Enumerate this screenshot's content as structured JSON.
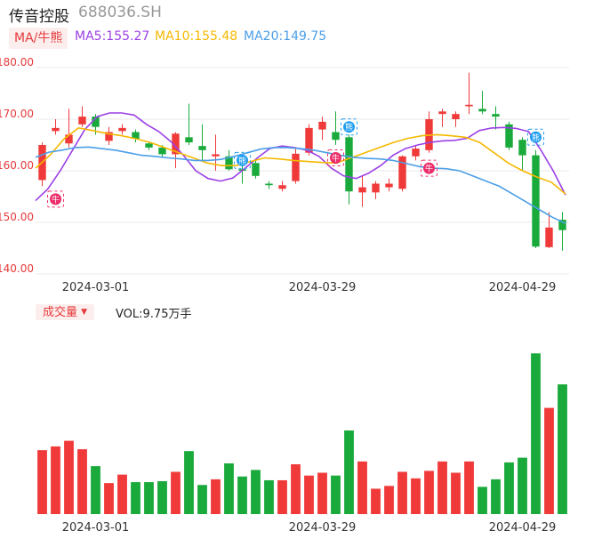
{
  "header": {
    "name": "传音控股",
    "code": "688036.SH"
  },
  "legend": {
    "ma_label": "MA/牛熊",
    "items": [
      {
        "label": "MA5:155.27",
        "color": "#9b40e6"
      },
      {
        "label": "MA10:155.48",
        "color": "#f5b800"
      },
      {
        "label": "MA20:149.75",
        "color": "#4b9ee8"
      }
    ]
  },
  "volume": {
    "label": "成交量",
    "text": "VOL:9.75万手"
  },
  "colors": {
    "up": "#f03a3a",
    "down": "#1aaa3c",
    "grid": "#e8e8e8",
    "axis": "#e5393b"
  },
  "chart_data": [
    {
      "type": "candlestick",
      "yticks": [
        "180.00",
        "170.00",
        "160.00",
        "150.00",
        "140.00"
      ],
      "ylim": [
        140,
        180
      ],
      "xtick_labels": [
        {
          "label": "2024-03-01",
          "index": 4
        },
        {
          "label": "2024-03-29",
          "index": 21
        },
        {
          "label": "2024-04-29",
          "index": 36
        }
      ],
      "candles": [
        {
          "o": 158.2,
          "c": 165.0,
          "h": 165.5,
          "l": 157.0
        },
        {
          "o": 167.7,
          "c": 168.3,
          "h": 170.0,
          "l": 167.0
        },
        {
          "o": 165.3,
          "c": 167.0,
          "h": 172.0,
          "l": 164.5
        },
        {
          "o": 169.0,
          "c": 170.5,
          "h": 172.5,
          "l": 168.5
        },
        {
          "o": 170.5,
          "c": 168.5,
          "h": 171.0,
          "l": 167.0
        },
        {
          "o": 165.8,
          "c": 167.5,
          "h": 168.5,
          "l": 165.0
        },
        {
          "o": 167.7,
          "c": 168.3,
          "h": 169.0,
          "l": 167.0
        },
        {
          "o": 167.5,
          "c": 166.2,
          "h": 168.0,
          "l": 165.5
        },
        {
          "o": 165.3,
          "c": 164.5,
          "h": 165.5,
          "l": 164.0
        },
        {
          "o": 164.5,
          "c": 163.2,
          "h": 165.0,
          "l": 162.5
        },
        {
          "o": 163.2,
          "c": 167.2,
          "h": 167.5,
          "l": 160.5
        },
        {
          "o": 166.5,
          "c": 165.5,
          "h": 173.0,
          "l": 165.0
        },
        {
          "o": 164.8,
          "c": 164.0,
          "h": 169.0,
          "l": 162.0
        },
        {
          "o": 162.8,
          "c": 163.2,
          "h": 167.0,
          "l": 160.0
        },
        {
          "o": 162.8,
          "c": 160.3,
          "h": 164.0,
          "l": 160.0
        },
        {
          "o": 160.3,
          "c": 160.0,
          "h": 161.0,
          "l": 157.5
        },
        {
          "o": 161.5,
          "c": 159.0,
          "h": 162.0,
          "l": 158.5
        },
        {
          "o": 157.5,
          "c": 157.2,
          "h": 158.0,
          "l": 156.5
        },
        {
          "o": 156.5,
          "c": 157.2,
          "h": 158.0,
          "l": 156.0
        },
        {
          "o": 158.0,
          "c": 163.3,
          "h": 164.5,
          "l": 157.5
        },
        {
          "o": 163.5,
          "c": 168.3,
          "h": 169.0,
          "l": 163.0
        },
        {
          "o": 168.0,
          "c": 169.5,
          "h": 170.5,
          "l": 166.0
        },
        {
          "o": 167.5,
          "c": 166.0,
          "h": 171.5,
          "l": 165.0
        },
        {
          "o": 166.5,
          "c": 156.0,
          "h": 167.0,
          "l": 153.5
        },
        {
          "o": 155.8,
          "c": 156.8,
          "h": 159.0,
          "l": 153.0
        },
        {
          "o": 155.8,
          "c": 157.5,
          "h": 158.0,
          "l": 154.5
        },
        {
          "o": 156.8,
          "c": 157.5,
          "h": 158.5,
          "l": 156.0
        },
        {
          "o": 156.5,
          "c": 162.8,
          "h": 163.0,
          "l": 156.0
        },
        {
          "o": 162.8,
          "c": 164.3,
          "h": 165.0,
          "l": 162.0
        },
        {
          "o": 164.0,
          "c": 170.0,
          "h": 171.5,
          "l": 163.5
        },
        {
          "o": 171.0,
          "c": 171.5,
          "h": 172.0,
          "l": 168.5
        },
        {
          "o": 170.0,
          "c": 171.0,
          "h": 171.5,
          "l": 168.5
        },
        {
          "o": 172.5,
          "c": 172.8,
          "h": 179.0,
          "l": 171.0
        },
        {
          "o": 172.0,
          "c": 171.5,
          "h": 175.5,
          "l": 171.0
        },
        {
          "o": 171.0,
          "c": 170.5,
          "h": 172.5,
          "l": 168.0
        },
        {
          "o": 169.0,
          "c": 164.5,
          "h": 169.5,
          "l": 164.0
        },
        {
          "o": 166.0,
          "c": 163.0,
          "h": 166.5,
          "l": 160.0
        },
        {
          "o": 163.0,
          "c": 145.3,
          "h": 164.0,
          "l": 145.0
        },
        {
          "o": 145.2,
          "c": 149.0,
          "h": 152.0,
          "l": 145.0
        },
        {
          "o": 150.5,
          "c": 148.5,
          "h": 152.0,
          "l": 144.5
        }
      ],
      "series": [
        {
          "name": "MA5",
          "color": "#9b40e6",
          "values": [
            154.2,
            156.5,
            160.0,
            164.0,
            168.0,
            170.5,
            171.2,
            171.2,
            170.8,
            169.0,
            167.6,
            165.6,
            163.0,
            160.0,
            158.5,
            158.0,
            158.6,
            160.5,
            162.5,
            164.3,
            164.8,
            164.5,
            164.0,
            162.8,
            160.5,
            159.0,
            158.5,
            159.5,
            161.0,
            163.0,
            164.3,
            165.0,
            165.5,
            165.8,
            165.9,
            166.3,
            167.8,
            168.3,
            168.4,
            168.2,
            167.6,
            164.0,
            160.0,
            155.3
          ]
        },
        {
          "name": "MA10",
          "color": "#f5b800",
          "values": [
            160.5,
            163.0,
            166.2,
            168.3,
            167.8,
            167.2,
            166.8,
            166.2,
            165.5,
            164.5,
            163.5,
            162.5,
            161.5,
            161.0,
            161.0,
            161.8,
            162.5,
            162.3,
            162.0,
            161.8,
            161.6,
            161.5,
            162.5,
            163.5,
            164.5,
            165.5,
            166.3,
            166.8,
            167.0,
            166.8,
            166.5,
            165.5,
            163.5,
            161.5,
            160.0,
            158.8,
            157.8,
            155.5
          ]
        },
        {
          "name": "MA20",
          "color": "#4b9ee8",
          "values": [
            162.6,
            163.6,
            164.0,
            164.5,
            164.6,
            164.3,
            164.0,
            163.5,
            163.0,
            162.8,
            162.5,
            162.3,
            162.0,
            162.0,
            162.2,
            162.8,
            163.5,
            164.2,
            164.5,
            164.5,
            164.3,
            164.0,
            163.5,
            163.0,
            162.6,
            162.4,
            162.3,
            162.0,
            161.4,
            160.8,
            160.5,
            160.4,
            160.0,
            159.0,
            158.0,
            157.0,
            155.5,
            154.0,
            152.5,
            151.0,
            149.8
          ]
        }
      ],
      "markers": [
        {
          "index": 1,
          "kind": "bull",
          "glyph": "牛",
          "y": 154.5
        },
        {
          "index": 15,
          "kind": "bear",
          "glyph": "熊",
          "y": 162.0
        },
        {
          "index": 22,
          "kind": "bull",
          "glyph": "牛",
          "y": 162.5
        },
        {
          "index": 23,
          "kind": "bear",
          "glyph": "熊",
          "y": 168.5
        },
        {
          "index": 29,
          "kind": "bull",
          "glyph": "牛",
          "y": 160.5
        },
        {
          "index": 37,
          "kind": "bear",
          "glyph": "熊",
          "y": 166.5
        }
      ]
    },
    {
      "type": "bar",
      "name": "成交量",
      "values": [
        6.8,
        7.2,
        7.8,
        6.9,
        5.1,
        3.3,
        4.2,
        3.4,
        3.4,
        3.5,
        4.5,
        6.7,
        3.1,
        3.7,
        5.4,
        4.0,
        4.7,
        3.6,
        3.6,
        5.3,
        4.1,
        4.4,
        4.1,
        8.9,
        5.6,
        2.7,
        3.0,
        4.5,
        3.8,
        4.6,
        5.6,
        4.4,
        5.6,
        2.9,
        3.7,
        5.5,
        6.0,
        17.1,
        11.3,
        13.8
      ],
      "ymax": 17.6
    }
  ]
}
